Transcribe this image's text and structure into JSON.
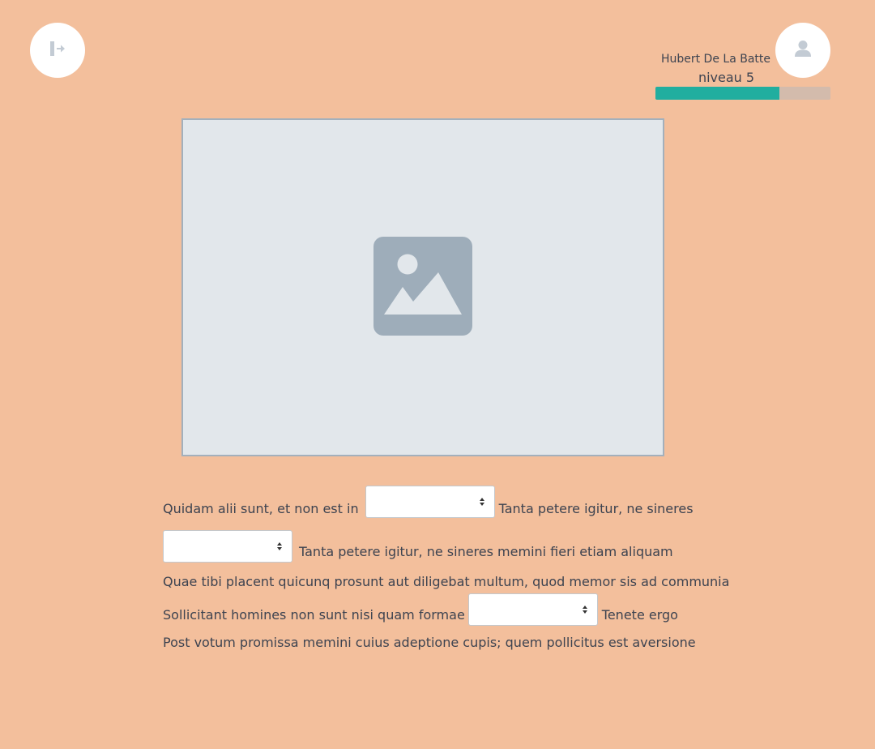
{
  "header": {
    "logout_icon": "logout-icon",
    "avatar_icon": "user-icon",
    "user_name": "Hubert De La Batte",
    "level_label": "niveau 5",
    "level_progress": 0.71,
    "colors": {
      "background": "#f3bf9c",
      "progress_fill": "#21ae9f",
      "progress_track": "#d3bbac"
    }
  },
  "media": {
    "placeholder_icon": "image-placeholder-icon"
  },
  "exercise": {
    "line1": {
      "before": "Quidam alii sunt, et non est in",
      "select_value": "",
      "after": "Tanta petere igitur, ne sineres"
    },
    "line2": {
      "select_value": "",
      "after": "Tanta petere igitur, ne sineres memini fieri etiam aliquam"
    },
    "line3": "Quae tibi placent quicunq prosunt aut diligebat multum, quod memor sis ad communia",
    "line4": {
      "before": "Sollicitant homines non sunt nisi quam formae",
      "select_value": "",
      "after": "Tenete ergo"
    },
    "line5": "Post votum promissa memini cuius adeptione cupis; quem pollicitus est aversione"
  }
}
